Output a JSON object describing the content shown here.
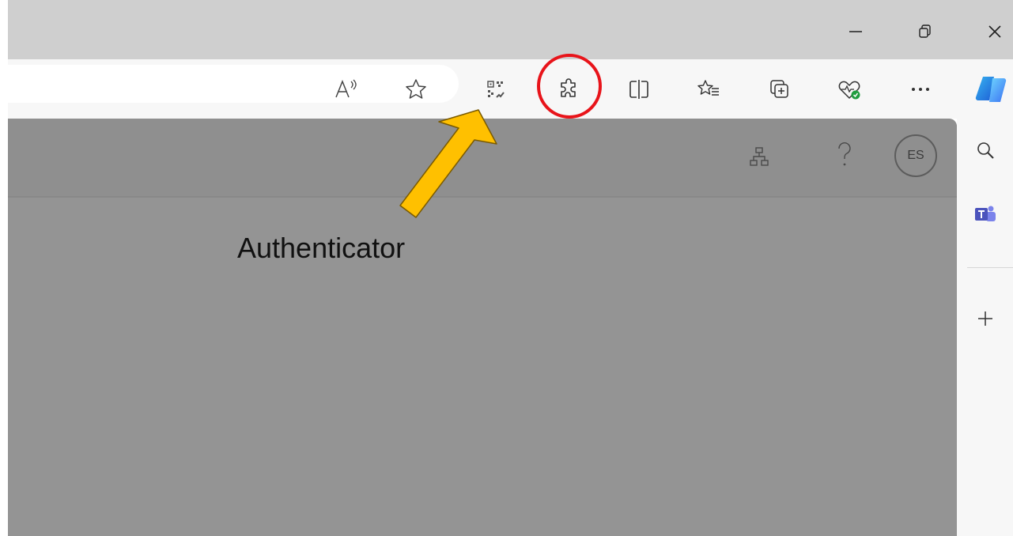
{
  "window_controls": {
    "minimize_icon": "minimize-icon",
    "restore_icon": "restore-icon",
    "close_icon": "close-icon"
  },
  "toolbar": {
    "icons": [
      "read-aloud-icon",
      "favorite-star-icon",
      "authenticator-qr-icon",
      "extensions-puzzle-icon",
      "split-screen-icon",
      "favorites-list-icon",
      "collections-icon",
      "browser-essentials-icon",
      "more-icon",
      "copilot-icon"
    ]
  },
  "content_header": {
    "icons": [
      "org-chart-icon",
      "help-icon"
    ],
    "avatar_initials": "ES"
  },
  "sidebar": {
    "icons": [
      "search-icon",
      "teams-icon",
      "add-icon"
    ]
  },
  "annotation": {
    "label": "Authenticator",
    "arrow_color": "#FFC000",
    "highlight_color": "#E8141A"
  }
}
